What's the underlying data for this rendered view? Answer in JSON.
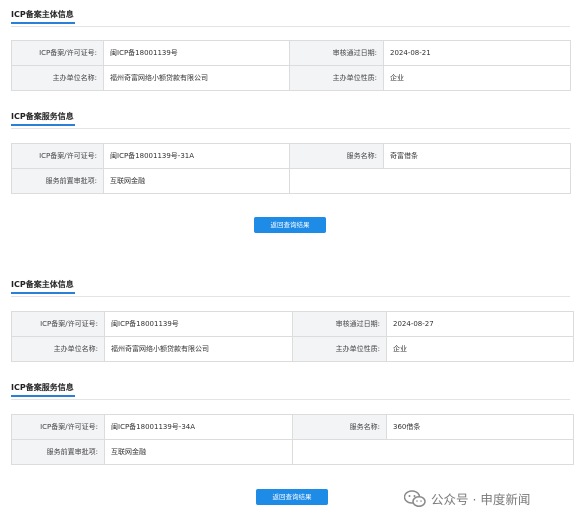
{
  "block1": {
    "subject_title": "ICP备案主体信息",
    "subject": {
      "license_label": "ICP备案/许可证号:",
      "license_value": "闽ICP备18001139号",
      "date_label": "审核通过日期:",
      "date_value": "2024-08-21",
      "org_label": "主办单位名称:",
      "org_value": "福州奇富网络小额贷款有限公司",
      "nature_label": "主办单位性质:",
      "nature_value": "企业"
    },
    "service_title": "ICP备案服务信息",
    "service": {
      "license_label": "ICP备案/许可证号:",
      "license_value": "闽ICP备18001139号-31A",
      "name_label": "服务名称:",
      "name_value": "奇富借条",
      "approval_label": "服务前置审批项:",
      "approval_value": "互联网金融"
    },
    "back_button": "返回查询结果"
  },
  "block2": {
    "subject_title": "ICP备案主体信息",
    "subject": {
      "license_label": "ICP备案/许可证号:",
      "license_value": "闽ICP备18001139号",
      "date_label": "审核通过日期:",
      "date_value": "2024-08-27",
      "org_label": "主办单位名称:",
      "org_value": "福州奇富网络小额贷款有限公司",
      "nature_label": "主办单位性质:",
      "nature_value": "企业"
    },
    "service_title": "ICP备案服务信息",
    "service": {
      "license_label": "ICP备案/许可证号:",
      "license_value": "闽ICP备18001139号-34A",
      "name_label": "服务名称:",
      "name_value": "360借条",
      "approval_label": "服务前置审批项:",
      "approval_value": "互联网金融"
    },
    "back_button": "返回查询结果"
  },
  "watermark": {
    "text": "公众号 · 申度新闻",
    "icon": "wechat-icon"
  },
  "colors": {
    "accent": "#1e8be6",
    "label_bg": "#f3f4f6",
    "border": "#dcdcdc"
  }
}
